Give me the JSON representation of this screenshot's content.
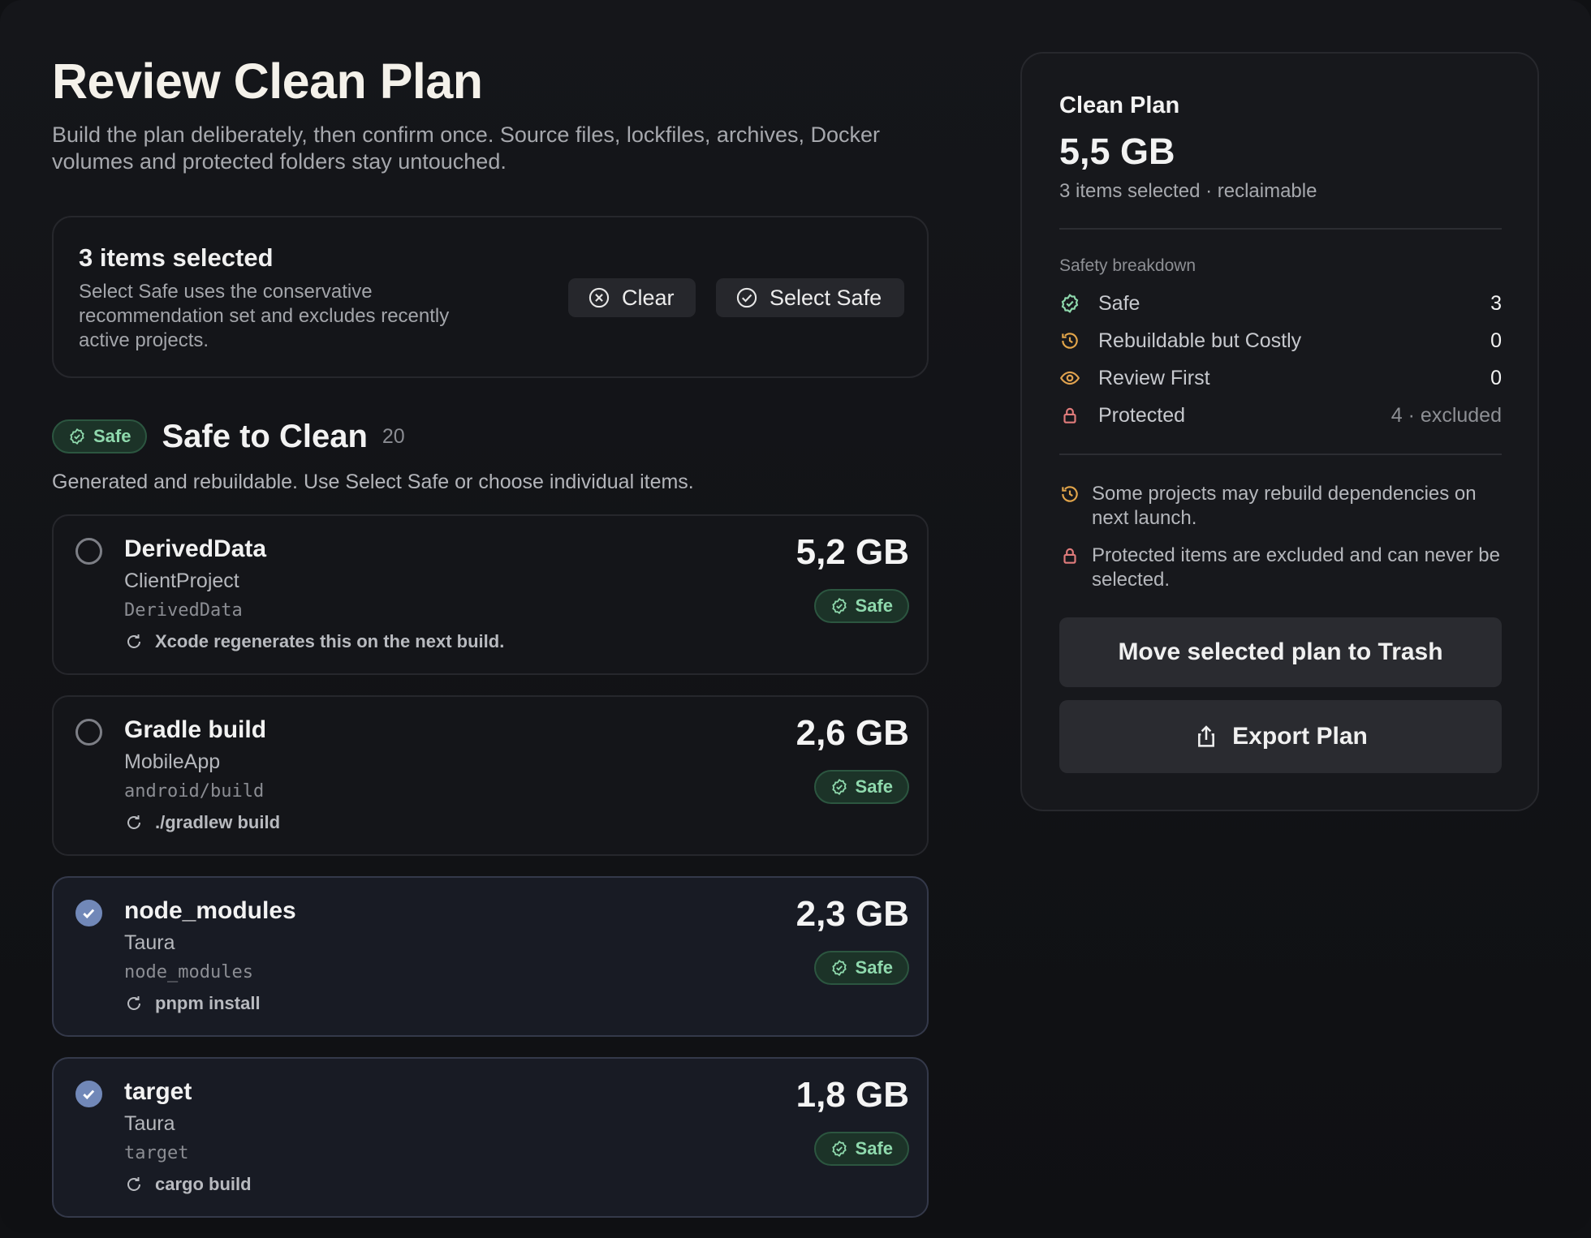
{
  "header": {
    "title": "Review Clean Plan",
    "description": "Build the plan deliberately, then confirm once. Source files, lockfiles, archives, Docker volumes and protected folders stay untouched."
  },
  "selection": {
    "title": "3 items selected",
    "description": "Select Safe uses the conservative recommendation set and excludes recently active projects.",
    "clear_label": "Clear",
    "select_safe_label": "Select Safe"
  },
  "section": {
    "badge": "Safe",
    "title": "Safe to Clean",
    "count": "20",
    "description": "Generated and rebuildable. Use Select Safe or choose individual items."
  },
  "items": [
    {
      "name": "DerivedData",
      "project": "ClientProject",
      "path": "DerivedData",
      "note": "Xcode regenerates this on the next build.",
      "size": "5,2 GB",
      "badge": "Safe",
      "selected": false
    },
    {
      "name": "Gradle build",
      "project": "MobileApp",
      "path": "android/build",
      "note": "./gradlew build",
      "size": "2,6 GB",
      "badge": "Safe",
      "selected": false
    },
    {
      "name": "node_modules",
      "project": "Taura",
      "path": "node_modules",
      "note": "pnpm install",
      "size": "2,3 GB",
      "badge": "Safe",
      "selected": true
    },
    {
      "name": "target",
      "project": "Taura",
      "path": "target",
      "note": "cargo build",
      "size": "1,8 GB",
      "badge": "Safe",
      "selected": true
    }
  ],
  "plan": {
    "title": "Clean Plan",
    "size": "5,5 GB",
    "subtitle": "3 items selected · reclaimable",
    "breakdown_label": "Safety breakdown",
    "breakdown": [
      {
        "label": "Safe",
        "value": "3",
        "icon": "safe-icon"
      },
      {
        "label": "Rebuildable but Costly",
        "value": "0",
        "icon": "history-icon"
      },
      {
        "label": "Review First",
        "value": "0",
        "icon": "eye-icon"
      },
      {
        "label": "Protected",
        "value": "4 · excluded",
        "icon": "lock-icon"
      }
    ],
    "notes": [
      {
        "text": "Some projects may rebuild dependencies on next launch.",
        "icon": "history-icon"
      },
      {
        "text": "Protected items are excluded and can never be selected.",
        "icon": "lock-icon"
      }
    ],
    "trash_label": "Move selected plan to Trash",
    "export_label": "Export Plan"
  },
  "colors": {
    "safe": "#8fd9ad",
    "costly": "#e2a54a",
    "review": "#e0a24f",
    "protected": "#e07b7b",
    "selected": "#7188b8"
  }
}
